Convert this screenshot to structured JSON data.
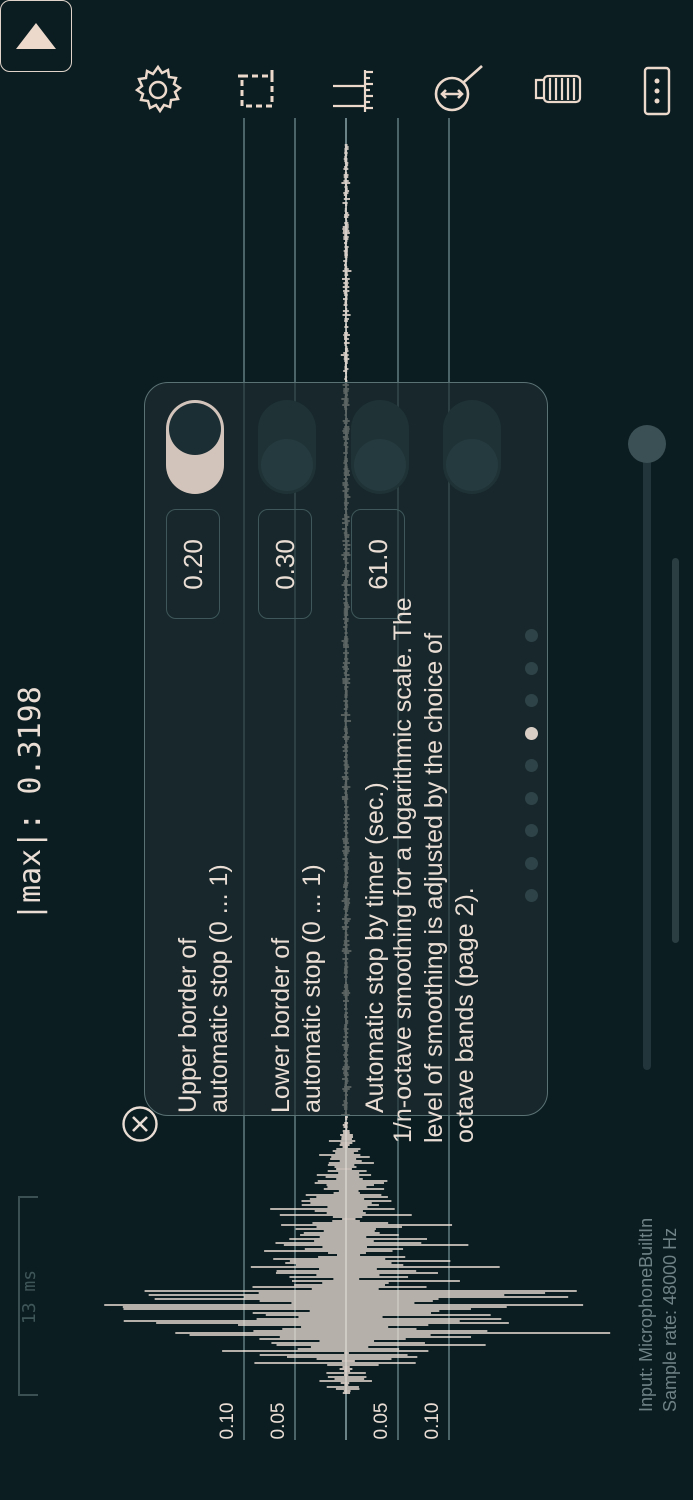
{
  "readout": {
    "max_label": "|max|: 0.3198"
  },
  "scale_bar": {
    "label": "13 ms"
  },
  "axis": {
    "left": [
      "0.10",
      "0.05"
    ],
    "right": [
      "0.05",
      "0.10"
    ]
  },
  "input_info": {
    "input": "Input: MicrophoneBuiltIn",
    "rate": "Sample rate: 48000 Hz"
  },
  "settings_panel": {
    "rows": [
      {
        "label_line1": "Upper border of",
        "label_line2": "automatic stop (0 ... 1)",
        "value": "0.20",
        "toggle_on": true
      },
      {
        "label_line1": "Lower border of",
        "label_line2": "automatic stop (0 ... 1)",
        "value": "0.30",
        "toggle_on": false
      },
      {
        "label_line1": "Automatic stop by timer (sec.)",
        "label_line2": "",
        "value": "61.0",
        "toggle_on": false
      }
    ],
    "description": {
      "line1": "1/n-octave smoothing for a logarithmic scale. The",
      "line2": "level of smoothing is adjusted by the choice of",
      "line3": "octave bands (page 2)."
    },
    "pages": {
      "count": 9,
      "active_index": 5
    }
  },
  "toolbar": [
    "play",
    "settings",
    "select-region",
    "ruler",
    "zoom",
    "clear",
    "more-options"
  ],
  "colors": {
    "background": "#0b1d21",
    "accent": "#ecd9cc",
    "panel": "#1e2e30",
    "grid": "#4a6468"
  }
}
